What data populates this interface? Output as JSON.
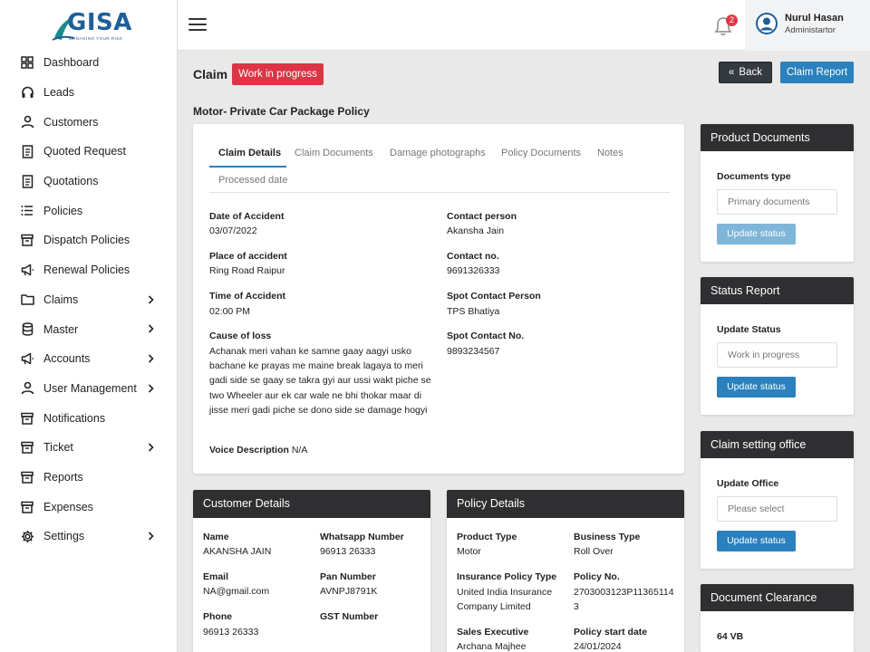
{
  "brand": {
    "name": "GISA",
    "tagline": "MANAGING YOUR RISK"
  },
  "sidebar": {
    "items": [
      {
        "label": "Dashboard",
        "icon": "grid-icon",
        "has_children": false
      },
      {
        "label": "Leads",
        "icon": "headset-icon",
        "has_children": false
      },
      {
        "label": "Customers",
        "icon": "user-icon",
        "has_children": false
      },
      {
        "label": "Quoted Request",
        "icon": "document-icon",
        "has_children": false
      },
      {
        "label": "Quotations",
        "icon": "document-icon",
        "has_children": false
      },
      {
        "label": "Policies",
        "icon": "list-icon",
        "has_children": false
      },
      {
        "label": "Dispatch Policies",
        "icon": "archive-icon",
        "has_children": false
      },
      {
        "label": "Renewal Policies",
        "icon": "megaphone-icon",
        "has_children": false
      },
      {
        "label": "Claims",
        "icon": "folder-icon",
        "has_children": true
      },
      {
        "label": "Master",
        "icon": "database-icon",
        "has_children": true
      },
      {
        "label": "Accounts",
        "icon": "megaphone-icon",
        "has_children": true
      },
      {
        "label": "User Management",
        "icon": "user-icon",
        "has_children": true
      },
      {
        "label": "Notifications",
        "icon": "archive-icon",
        "has_children": false
      },
      {
        "label": "Ticket",
        "icon": "archive-icon",
        "has_children": true
      },
      {
        "label": "Reports",
        "icon": "archive-icon",
        "has_children": false
      },
      {
        "label": "Expenses",
        "icon": "archive-icon",
        "has_children": false
      },
      {
        "label": "Settings",
        "icon": "gear-icon",
        "has_children": true
      }
    ]
  },
  "topbar": {
    "notification_count": "2",
    "user_name": "Nurul Hasan",
    "user_role": "Administartor"
  },
  "header": {
    "title": "Claim",
    "status": "Work in progress",
    "back_label": "Back",
    "report_label": "Claim Report",
    "policy_name": "Motor- Private Car Package Policy"
  },
  "tabs": [
    "Claim Details",
    "Claim Documents",
    "Damage photographs",
    "Policy Documents",
    "Notes",
    "Processed date"
  ],
  "claim": {
    "date_label": "Date of Accident",
    "date_value": "03/07/2022",
    "place_label": "Place of accident",
    "place_value": "Ring Road Raipur",
    "time_label": "Time of Accident",
    "time_value": "02:00 PM",
    "cause_label": "Cause of loss",
    "cause_value": "Achanak meri vahan ke samne gaay aagyi usko bachane ke prayas me maine break lagaya to meri gadi side se gaay se takra gyi aur ussi wakt piche se two Wheeler aur ek car wale ne bhi thokar maar di jisse meri gadi piche se dono side se damage hogyi",
    "voice_label": "Voice Description",
    "voice_value": "N/A",
    "contact_person_label": "Contact person",
    "contact_person_value": "Akansha Jain",
    "contact_no_label": "Contact no.",
    "contact_no_value": "9691326333",
    "spot_person_label": "Spot Contact Person",
    "spot_person_value": "TPS Bhatiya",
    "spot_no_label": "Spot Contact No.",
    "spot_no_value": "9893234567"
  },
  "panels": {
    "product_documents": {
      "title": "Product Documents",
      "label": "Documents type",
      "placeholder": "Primary documents",
      "button": "Update status"
    },
    "status_report": {
      "title": "Status Report",
      "label": "Update Status",
      "placeholder": "Work in progress",
      "button": "Update status"
    },
    "claim_office": {
      "title": "Claim setting office",
      "label": "Update Office",
      "placeholder": "Please select",
      "button": "Update status"
    },
    "document_clearance": {
      "title": "Document Clearance",
      "label": "64 VB"
    }
  },
  "customer": {
    "title": "Customer Details",
    "name_label": "Name",
    "name_value": "AKANSHA JAIN",
    "whatsapp_label": "Whatsapp Number",
    "whatsapp_value": "96913 26333",
    "email_label": "Email",
    "email_value": "NA@gmail.com",
    "pan_label": "Pan Number",
    "pan_value": "AVNPJ8791K",
    "phone_label": "Phone",
    "phone_value": "96913 26333",
    "gst_label": "GST Number"
  },
  "policy": {
    "title": "Policy Details",
    "product_type_label": "Product Type",
    "product_type_value": "Motor",
    "business_type_label": "Business Type",
    "business_type_value": "Roll Over",
    "insurance_label": "Insurance Policy Type",
    "insurance_value": "United India Insurance Company Limited",
    "policy_no_label": "Policy No.",
    "policy_no_value": "2703003123P113651143",
    "sales_label": "Sales Executive",
    "sales_value": "Archana Majhee",
    "start_label": "Policy start date",
    "start_value": "24/01/2024"
  },
  "colors": {
    "primary": "#2a81bd",
    "danger": "#dc3545",
    "dark": "#2f2f31"
  }
}
